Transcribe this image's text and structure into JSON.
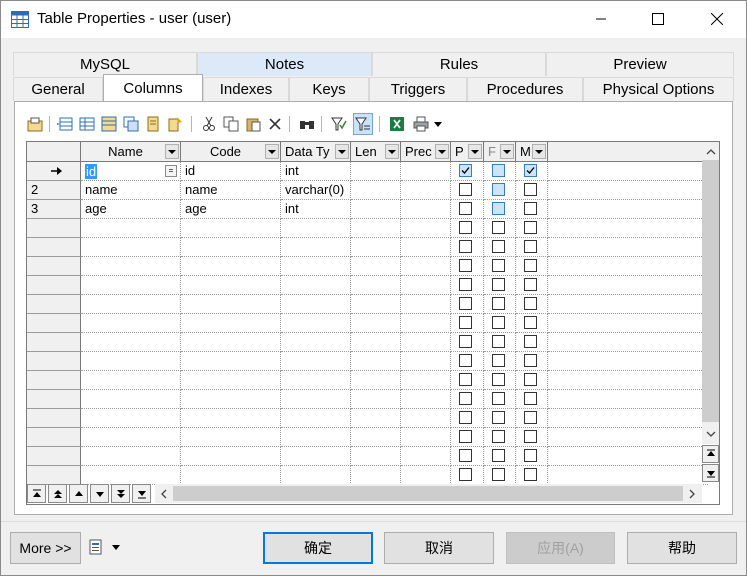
{
  "window": {
    "title": "Table Properties - user (user)",
    "icon": "table-icon",
    "controls": [
      "minimize-icon",
      "maximize-icon",
      "close-icon"
    ]
  },
  "tabs": {
    "row_top": [
      "MySQL",
      "Notes",
      "Rules",
      "Preview"
    ],
    "row_bottom": [
      "General",
      "Columns",
      "Indexes",
      "Keys",
      "Triggers",
      "Procedures",
      "Physical Options"
    ],
    "active": "Columns"
  },
  "toolbar": {
    "icons": [
      "properties-icon",
      "insert-row-icon",
      "add-row-icon",
      "add-columns-icon",
      "replicate-icon",
      "new-icon",
      "paste-special-icon",
      "cut-icon",
      "copy-icon",
      "paste-icon",
      "delete-icon",
      "find-icon",
      "filter-icon",
      "customize-columns-icon",
      "excel-export-icon",
      "print-icon",
      "dropdown-icon"
    ]
  },
  "grid": {
    "headers": [
      "Name",
      "Code",
      "Data Ty",
      "Len",
      "Prec",
      "P",
      "F",
      "M"
    ],
    "rows": [
      {
        "num": "",
        "marker": "arrow",
        "name": "id",
        "code": "id",
        "type": "int",
        "len": "",
        "prec": "",
        "p": true,
        "f": false,
        "m": true
      },
      {
        "num": "2",
        "marker": "",
        "name": "name",
        "code": "name",
        "type": "varchar(0)",
        "len": "",
        "prec": "",
        "p": false,
        "f": false,
        "m": false
      },
      {
        "num": "3",
        "marker": "",
        "name": "age",
        "code": "age",
        "type": "int",
        "len": "",
        "prec": "",
        "p": false,
        "f": false,
        "m": false
      }
    ],
    "empty_rows": 14
  },
  "nav": {
    "icons": [
      "move-top-icon",
      "move-up-page-icon",
      "move-up-icon",
      "move-down-icon",
      "move-down-page-icon",
      "move-bottom-icon"
    ]
  },
  "footer": {
    "more_label": "More >>",
    "ok_label": "确定",
    "cancel_label": "取消",
    "apply_label": "应用(A)",
    "help_label": "帮助"
  },
  "colors": {
    "accent": "#0078d7",
    "selection": "#3399ff",
    "notes_tab": "#dce9f8"
  }
}
